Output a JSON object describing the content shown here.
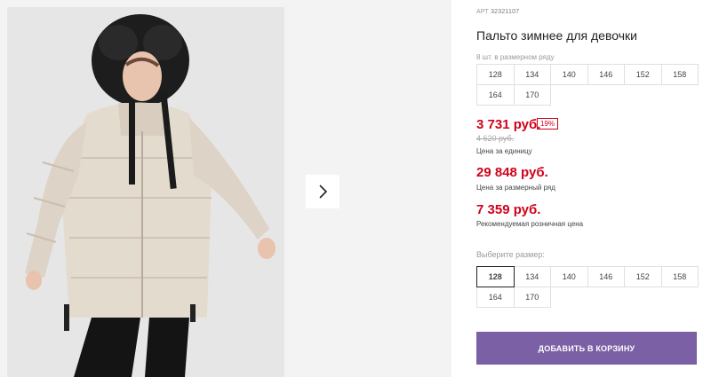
{
  "product": {
    "sku_label": "АРТ",
    "sku": "32321107",
    "title": "Пальто зимнее для девочки"
  },
  "pack": {
    "label": "8 шт. в размерном ряду",
    "sizes": [
      "128",
      "134",
      "140",
      "146",
      "152",
      "158",
      "164",
      "170"
    ]
  },
  "prices": {
    "unit_price": "3 731 руб.",
    "discount": "19%",
    "old_price": "4 620 руб.",
    "unit_label": "Цена за единицу",
    "pack_price": "29 848 руб.",
    "pack_label": "Цена за размерный ряд",
    "rrp": "7 359 руб.",
    "rrp_label": "Рекомендуемая розничная цена",
    "price_color": "#d0021b"
  },
  "size_select": {
    "label": "Выберите размер:",
    "sizes": [
      "128",
      "134",
      "140",
      "146",
      "152",
      "158",
      "164",
      "170"
    ],
    "selected": "128"
  },
  "cart_button": {
    "label": "ДОБАВИТЬ В КОРЗИНУ",
    "color": "#7b60a5"
  },
  "gallery": {
    "next_icon": "chevron-right-icon"
  }
}
